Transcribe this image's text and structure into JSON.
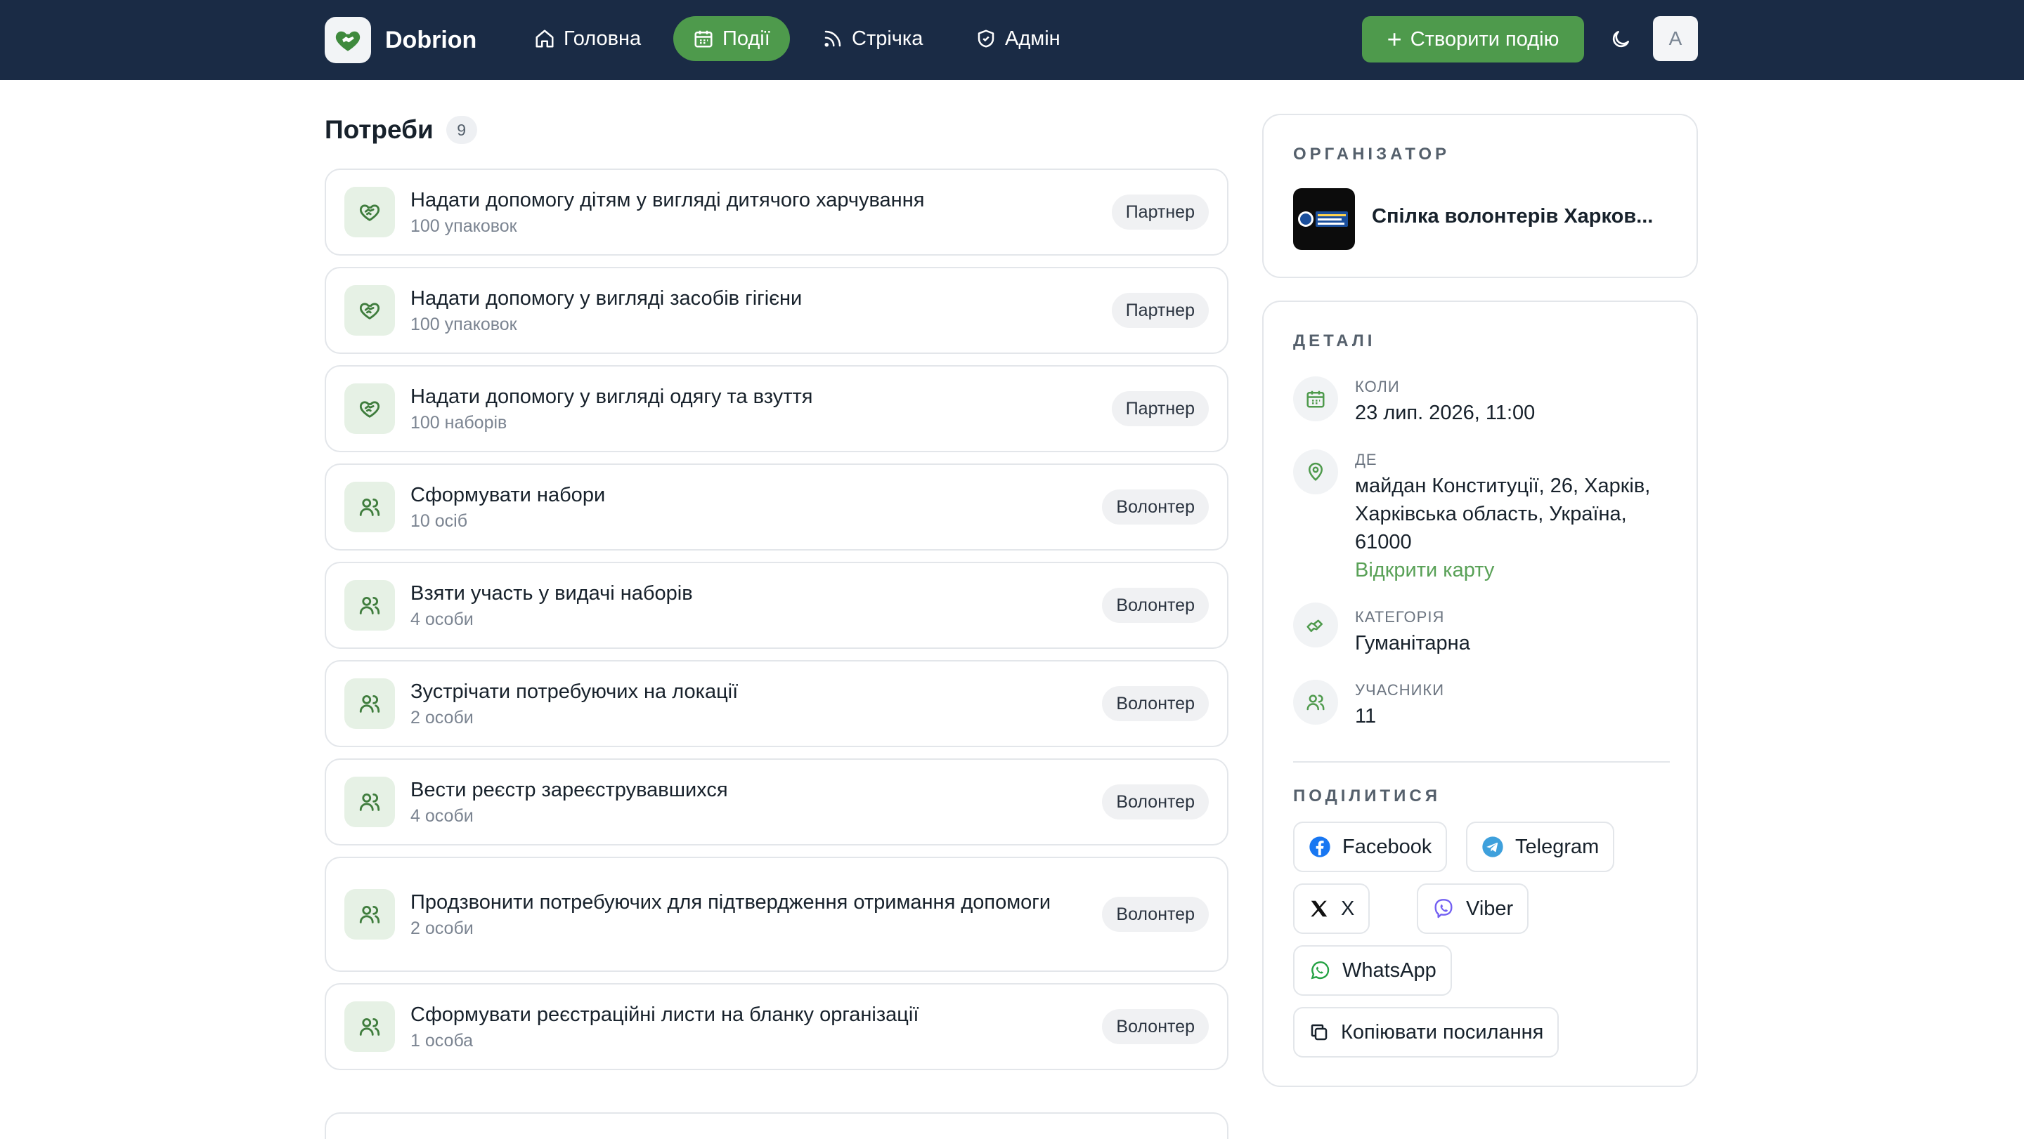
{
  "header": {
    "brand": "Dobrion",
    "nav": [
      {
        "label": "Головна",
        "icon": "home-icon"
      },
      {
        "label": "Події",
        "icon": "calendar-icon",
        "active": true
      },
      {
        "label": "Стрічка",
        "icon": "rss-icon"
      },
      {
        "label": "Адмін",
        "icon": "shield-icon"
      }
    ],
    "create_label": "Створити подію",
    "avatar_initial": "A"
  },
  "needs": {
    "title": "Потреби",
    "count": "9",
    "items": [
      {
        "title": "Надати допомогу дітям у вигляді дитячого харчування",
        "sub": "100 упаковок",
        "tag": "Партнер",
        "icon": "handshake-icon"
      },
      {
        "title": "Надати допомогу у вигляді засобів гігієни",
        "sub": "100 упаковок",
        "tag": "Партнер",
        "icon": "handshake-icon"
      },
      {
        "title": "Надати допомогу у вигляді одягу та взуття",
        "sub": "100 наборів",
        "tag": "Партнер",
        "icon": "handshake-icon"
      },
      {
        "title": "Сформувати набори",
        "sub": "10 осіб",
        "tag": "Волонтер",
        "icon": "users-icon"
      },
      {
        "title": "Взяти участь у видачі наборів",
        "sub": "4 особи",
        "tag": "Волонтер",
        "icon": "users-icon"
      },
      {
        "title": "Зустрічати потребуючих на локації",
        "sub": "2 особи",
        "tag": "Волонтер",
        "icon": "users-icon"
      },
      {
        "title": "Вести реєстр зареєструвавшихся",
        "sub": "4 особи",
        "tag": "Волонтер",
        "icon": "users-icon"
      },
      {
        "title": "Продзвонити потребуючих для підтвердження отримання допомоги",
        "sub": "2 особи",
        "tag": "Волонтер",
        "icon": "users-icon"
      },
      {
        "title": "Сформувати реєстраційні листи на бланку організації",
        "sub": "1 особа",
        "tag": "Волонтер",
        "icon": "users-icon"
      }
    ]
  },
  "organizer": {
    "label": "ОРГАНІЗАТОР",
    "name": "Спілка волонтерів Харков..."
  },
  "details": {
    "label": "ДЕТАЛІ",
    "when_key": "КОЛИ",
    "when_val": "23 лип. 2026, 11:00",
    "where_key": "ДЕ",
    "where_val": "майдан Конституції, 26, Харків, Харківська область, Україна, 61000",
    "map_link": "Відкрити карту",
    "category_key": "КАТЕГОРІЯ",
    "category_val": "Гуманітарна",
    "participants_key": "УЧАСНИКИ",
    "participants_val": "11"
  },
  "share": {
    "label": "ПОДІЛИТИСЯ",
    "facebook": "Facebook",
    "telegram": "Telegram",
    "x": "X",
    "viber": "Viber",
    "whatsapp": "WhatsApp",
    "copy": "Копіювати посилання"
  },
  "colors": {
    "header_bg": "#1a2b45",
    "accent": "#4e9a4c",
    "link": "#59a157"
  }
}
